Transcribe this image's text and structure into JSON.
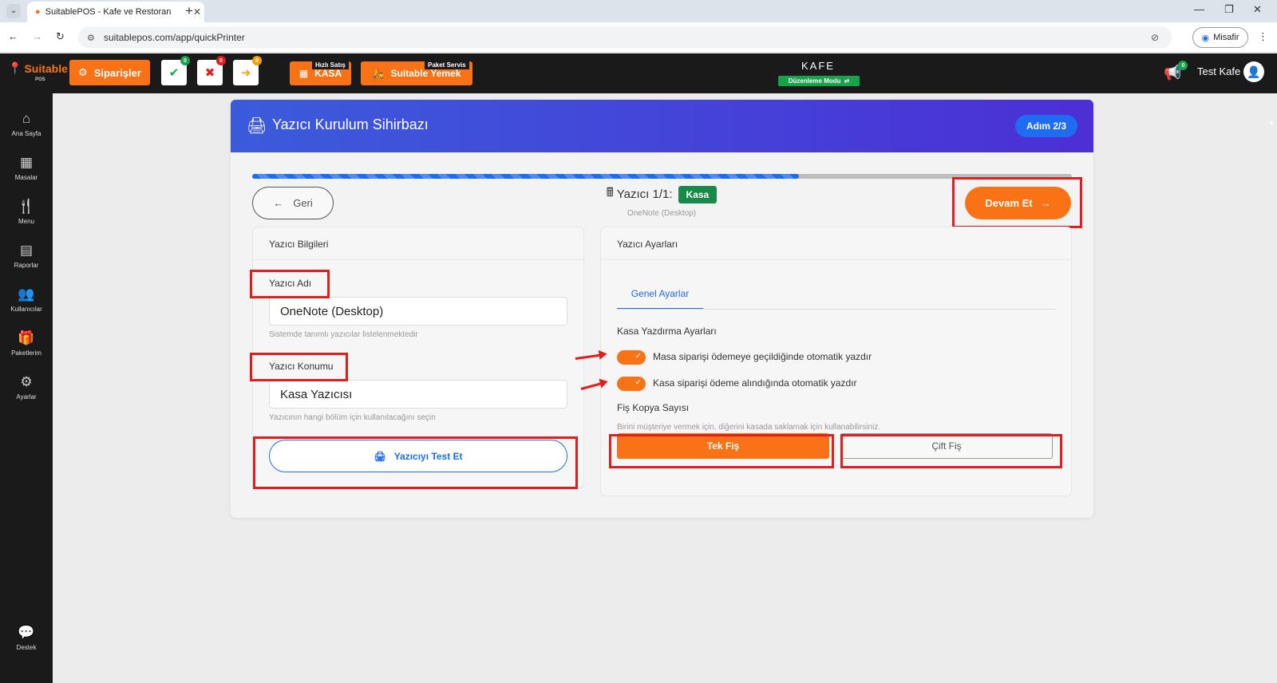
{
  "browser": {
    "tab_title": "SuitablePOS - Kafe ve Restoran",
    "url": "suitablepos.com/app/quickPrinter",
    "profile_label": "Misafir"
  },
  "header": {
    "logo_text": "Suitable",
    "logo_sub": "POS",
    "orders_label": "Siparişler",
    "count_approved": "0",
    "count_rejected": "0",
    "count_forwarded": "0",
    "quick_sale_tag": "Hızlı Satış",
    "kasa_label": "KASA",
    "delivery_tag": "Paket Servis",
    "delivery_label": "Suitable Yemek",
    "venue": "KAFE",
    "edit_mode": "Düzenleme Modu",
    "notif_count": "0",
    "user_name": "Test Kafe"
  },
  "sidebar": {
    "items": [
      {
        "label": "Ana Sayfa",
        "icon": "home-icon"
      },
      {
        "label": "Masalar",
        "icon": "tables-icon"
      },
      {
        "label": "Menu",
        "icon": "utensils-icon"
      },
      {
        "label": "Raporlar",
        "icon": "report-icon"
      },
      {
        "label": "Kullanıcılar",
        "icon": "users-icon"
      },
      {
        "label": "Paketlerim",
        "icon": "gift-icon"
      },
      {
        "label": "Ayarlar",
        "icon": "gears-icon"
      }
    ],
    "support_label": "Destek"
  },
  "wizard": {
    "title": "Yazıcı Kurulum Sihirbazı",
    "step": "Adım 2/3",
    "progress": 0.667,
    "back_label": "Geri",
    "printer_counter": "Yazıcı 1/1:",
    "printer_badge": "Kasa",
    "printer_sub": "OneNote (Desktop)",
    "continue_label": "Devam Et"
  },
  "left_panel": {
    "title": "Yazıcı Bilgileri",
    "name_label": "Yazıcı Adı",
    "name_value": "OneNote (Desktop)",
    "name_help": "Sistemde tanımlı yazıcılar listelenmektedir",
    "location_label": "Yazıcı Konumu",
    "location_value": "Kasa Yazıcısı",
    "location_help": "Yazıcının hangi bölüm için kullanılacağını seçin",
    "test_label": "Yazıcıyı Test Et"
  },
  "right_panel": {
    "title": "Yazıcı Ayarları",
    "tab_general": "Genel Ayarlar",
    "section_title": "Kasa Yazdırma Ayarları",
    "toggle1": "Masa siparişi ödemeye geçildiğinde otomatik yazdır",
    "toggle2": "Kasa siparişi ödeme alındığında otomatik yazdır",
    "copies_title": "Fiş Kopya Sayısı",
    "copies_help": "Birini müşteriye vermek için, diğerini kasada saklamak için kullanabilirsiniz.",
    "single_label": "Tek Fiş",
    "double_label": "Çift Fiş"
  },
  "colors": {
    "accent": "#f97316",
    "primary": "#1d6cf2",
    "highlight": "#e11d1d",
    "success": "#16a34a"
  }
}
